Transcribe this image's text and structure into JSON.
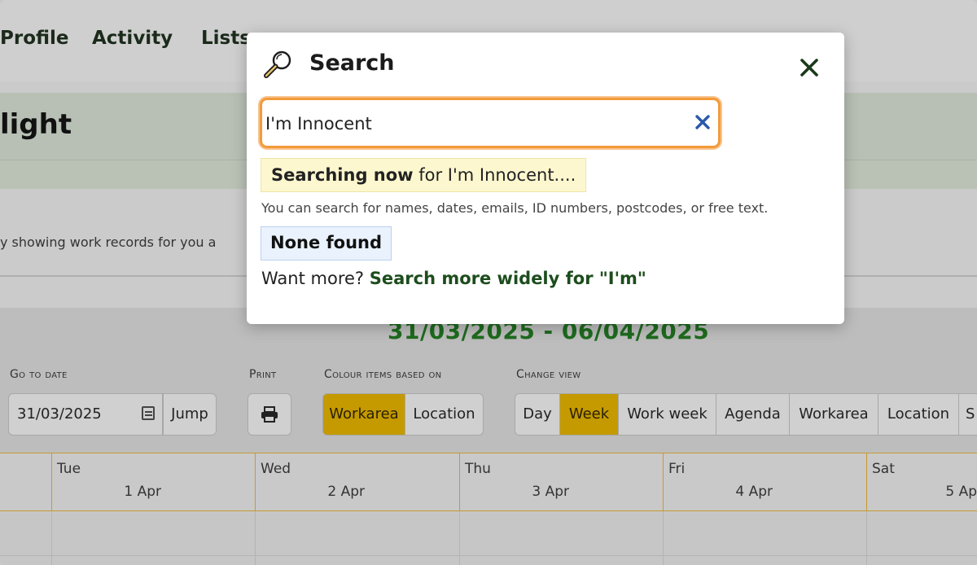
{
  "nav": {
    "items": [
      "Profile",
      "Activity",
      "Lists"
    ]
  },
  "page": {
    "title_fragment": "light",
    "info_text": "y showing work records for you a",
    "date_range": "31/03/2025 - 06/04/2025"
  },
  "controls": {
    "goto_label": "Go to date",
    "date_value": "31/03/2025",
    "jump_label": "Jump",
    "print_label": "Print",
    "colour_label": "Colour items based on",
    "colour_options": [
      "Workarea",
      "Location"
    ],
    "colour_selected": "Workarea",
    "view_label": "Change view",
    "view_options": [
      "Day",
      "Week",
      "Work week",
      "Agenda",
      "Workarea",
      "Location",
      "S"
    ],
    "view_selected": "Week"
  },
  "calendar": {
    "days": [
      {
        "name": "Tue",
        "date": "1 Apr"
      },
      {
        "name": "Wed",
        "date": "2 Apr"
      },
      {
        "name": "Thu",
        "date": "3 Apr"
      },
      {
        "name": "Fri",
        "date": "4 Apr"
      },
      {
        "name": "Sat",
        "date": "5 Ap"
      }
    ]
  },
  "modal": {
    "title": "Search",
    "search_value": "I'm Innocent",
    "searching_bold": "Searching now",
    "searching_rest": " for I'm Innocent....",
    "hint": "You can search for names, dates, emails, ID numbers, postcodes, or free text.",
    "none_found": "None found",
    "more_prefix": "Want more? ",
    "more_link": "Search more widely for \"I'm\""
  },
  "colors": {
    "accent_orange": "#f39a3a",
    "active_gold": "#c49a00",
    "green_text": "#1e6b1e"
  }
}
